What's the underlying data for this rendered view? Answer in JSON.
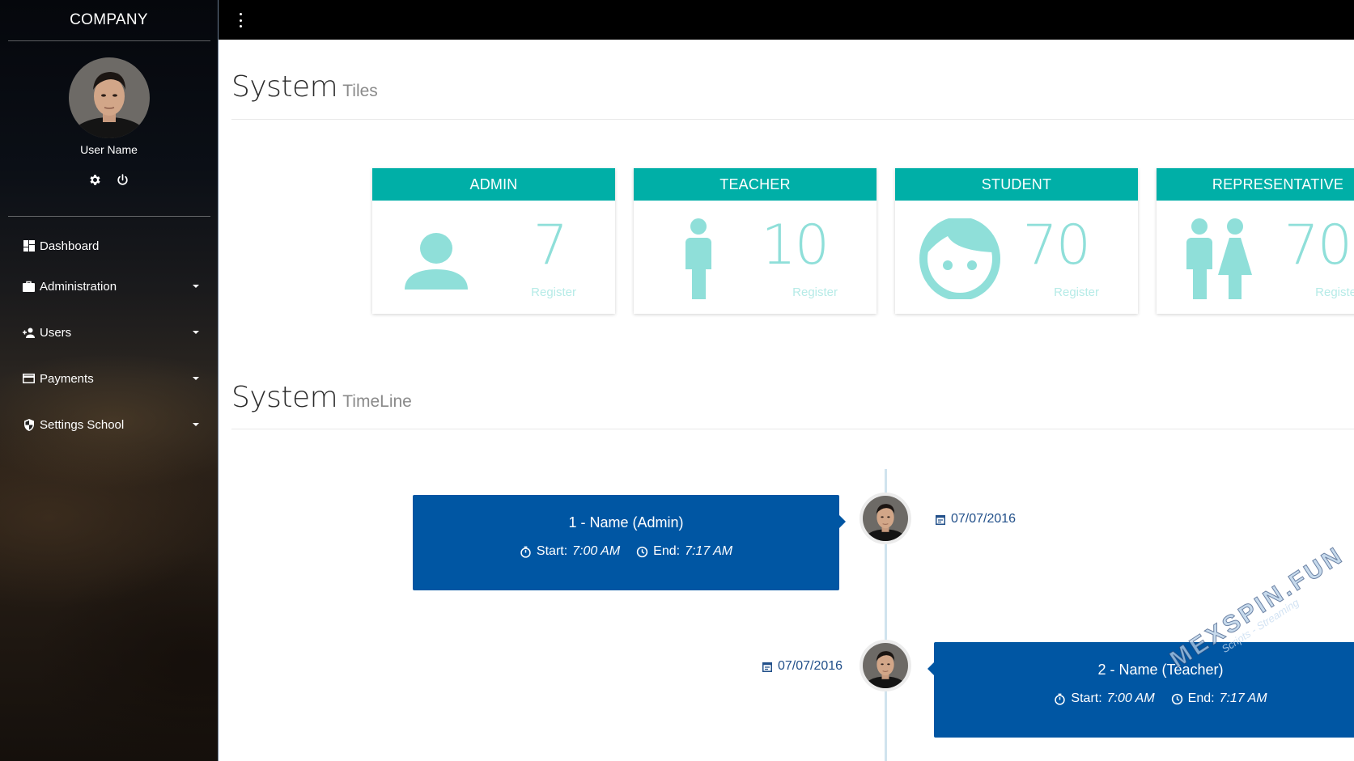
{
  "sidebar": {
    "brand": "COMPANY",
    "user_name": "User Name",
    "menu": [
      {
        "label": "Dashboard",
        "icon": "dashboard-icon",
        "has_submenu": false
      },
      {
        "label": "Administration",
        "icon": "briefcase-icon",
        "has_submenu": true
      },
      {
        "label": "Users",
        "icon": "person-add-icon",
        "has_submenu": true
      },
      {
        "label": "Payments",
        "icon": "credit-card-icon",
        "has_submenu": true
      },
      {
        "label": "Settings School",
        "icon": "security-shield-icon",
        "has_submenu": true
      }
    ]
  },
  "topbar": {
    "menu_icon": "more-vert-icon"
  },
  "tiles_section": {
    "title": "System",
    "subtitle": "Tiles"
  },
  "tiles": [
    {
      "label": "ADMIN",
      "count": "7",
      "caption": "Register",
      "icon": "person-icon"
    },
    {
      "label": "TEACHER",
      "count": "10",
      "caption": "Register",
      "icon": "standing-person-icon"
    },
    {
      "label": "STUDENT",
      "count": "70",
      "caption": "Register",
      "icon": "child-face-icon"
    },
    {
      "label": "REPRESENTATIVE",
      "count": "70",
      "caption": "Register",
      "icon": "man-woman-icon"
    }
  ],
  "timeline_section": {
    "title": "System",
    "subtitle": "TimeLine"
  },
  "timeline": [
    {
      "title": "1 - Name (Admin)",
      "start_label": "Start:",
      "start": "7:00 AM",
      "end_label": "End:",
      "end": "7:17 AM",
      "date": "07/07/2016"
    },
    {
      "title": "2 - Name (Teacher)",
      "start_label": "Start:",
      "start": "7:00 AM",
      "end_label": "End:",
      "end": "7:17 AM",
      "date": "07/07/2016"
    }
  ],
  "watermark": {
    "line1": "MEXSPIN.FUN",
    "line2": "Scripts - Streaming"
  },
  "colors": {
    "tile_header": "#00afa7",
    "tile_accent": "#8fdfd9",
    "timeline_card": "#0056a3",
    "topbar": "#000000"
  }
}
